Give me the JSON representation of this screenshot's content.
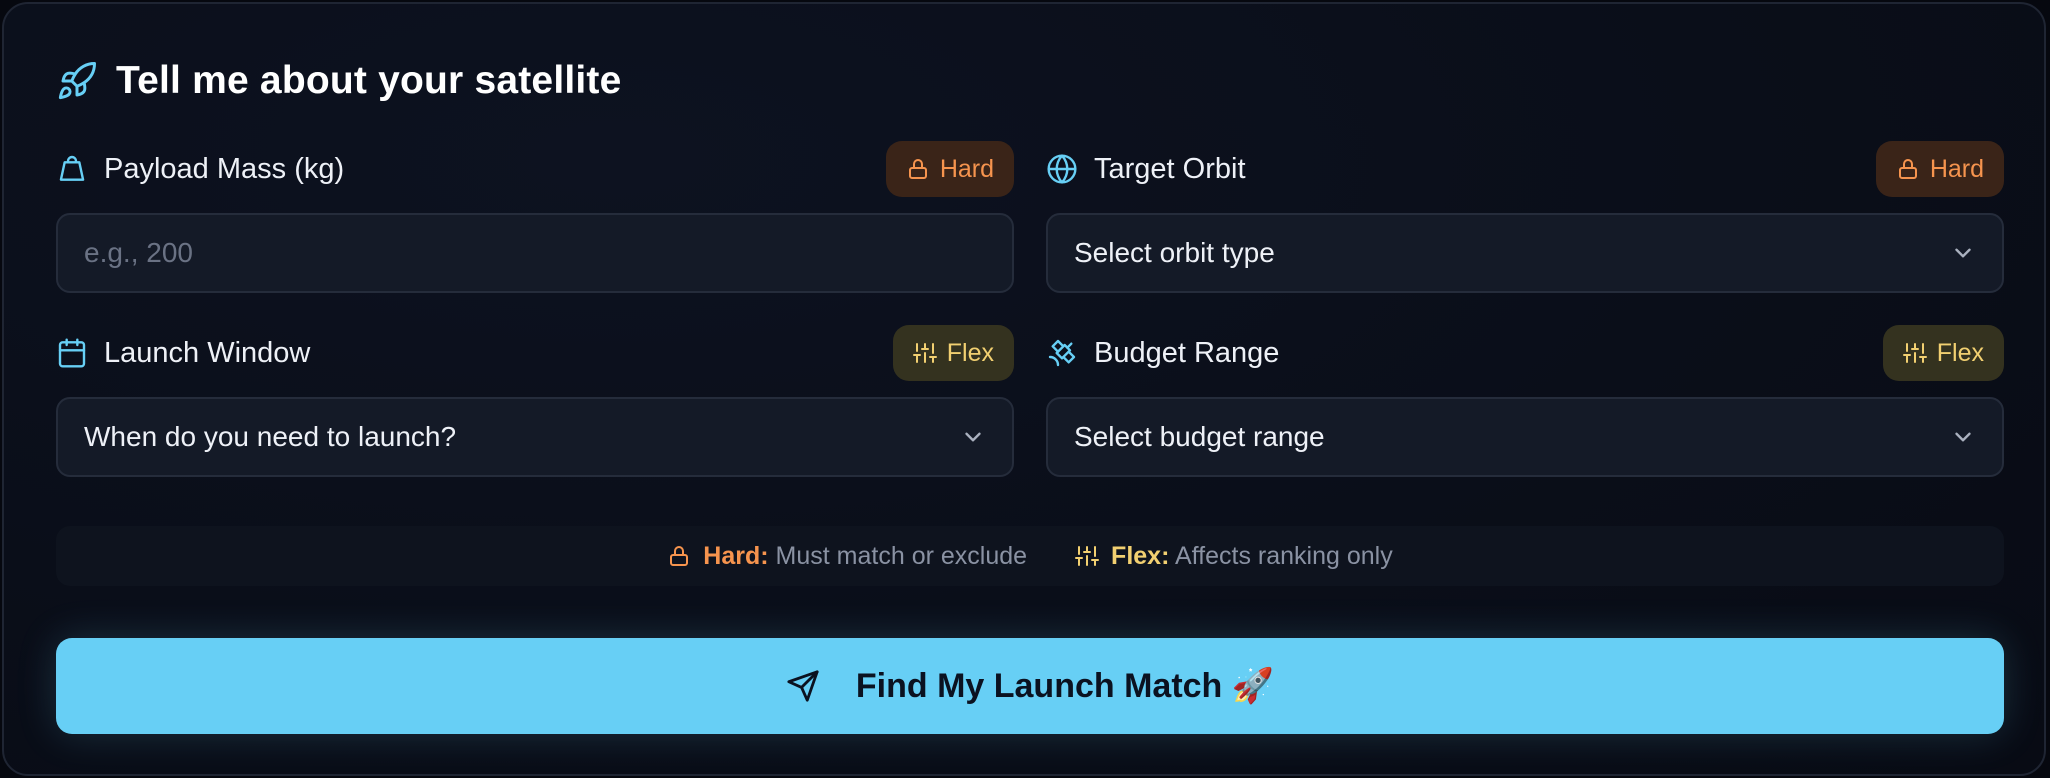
{
  "header": {
    "title": "Tell me about your satellite",
    "icon": "rocket-icon"
  },
  "colors": {
    "accent": "#67cff5",
    "hard": "#f6944e",
    "flex": "#f2d071",
    "card_bg": "#0a0e19"
  },
  "fields": {
    "payload": {
      "label": "Payload Mass (kg)",
      "icon": "weight-icon",
      "badge": "Hard",
      "placeholder": "e.g., 200",
      "value": ""
    },
    "orbit": {
      "label": "Target Orbit",
      "icon": "globe-icon",
      "badge": "Hard",
      "value": "Select orbit type"
    },
    "launch_window": {
      "label": "Launch Window",
      "icon": "calendar-icon",
      "badge": "Flex",
      "value": "When do you need to launch?"
    },
    "budget": {
      "label": "Budget Range",
      "icon": "satellite-icon",
      "badge": "Flex",
      "value": "Select budget range"
    }
  },
  "legend": {
    "hard_key": "Hard:",
    "hard_desc": "Must match or exclude",
    "flex_key": "Flex:",
    "flex_desc": "Affects ranking only"
  },
  "cta": {
    "label": "Find My Launch Match 🚀",
    "icon": "send-icon"
  }
}
